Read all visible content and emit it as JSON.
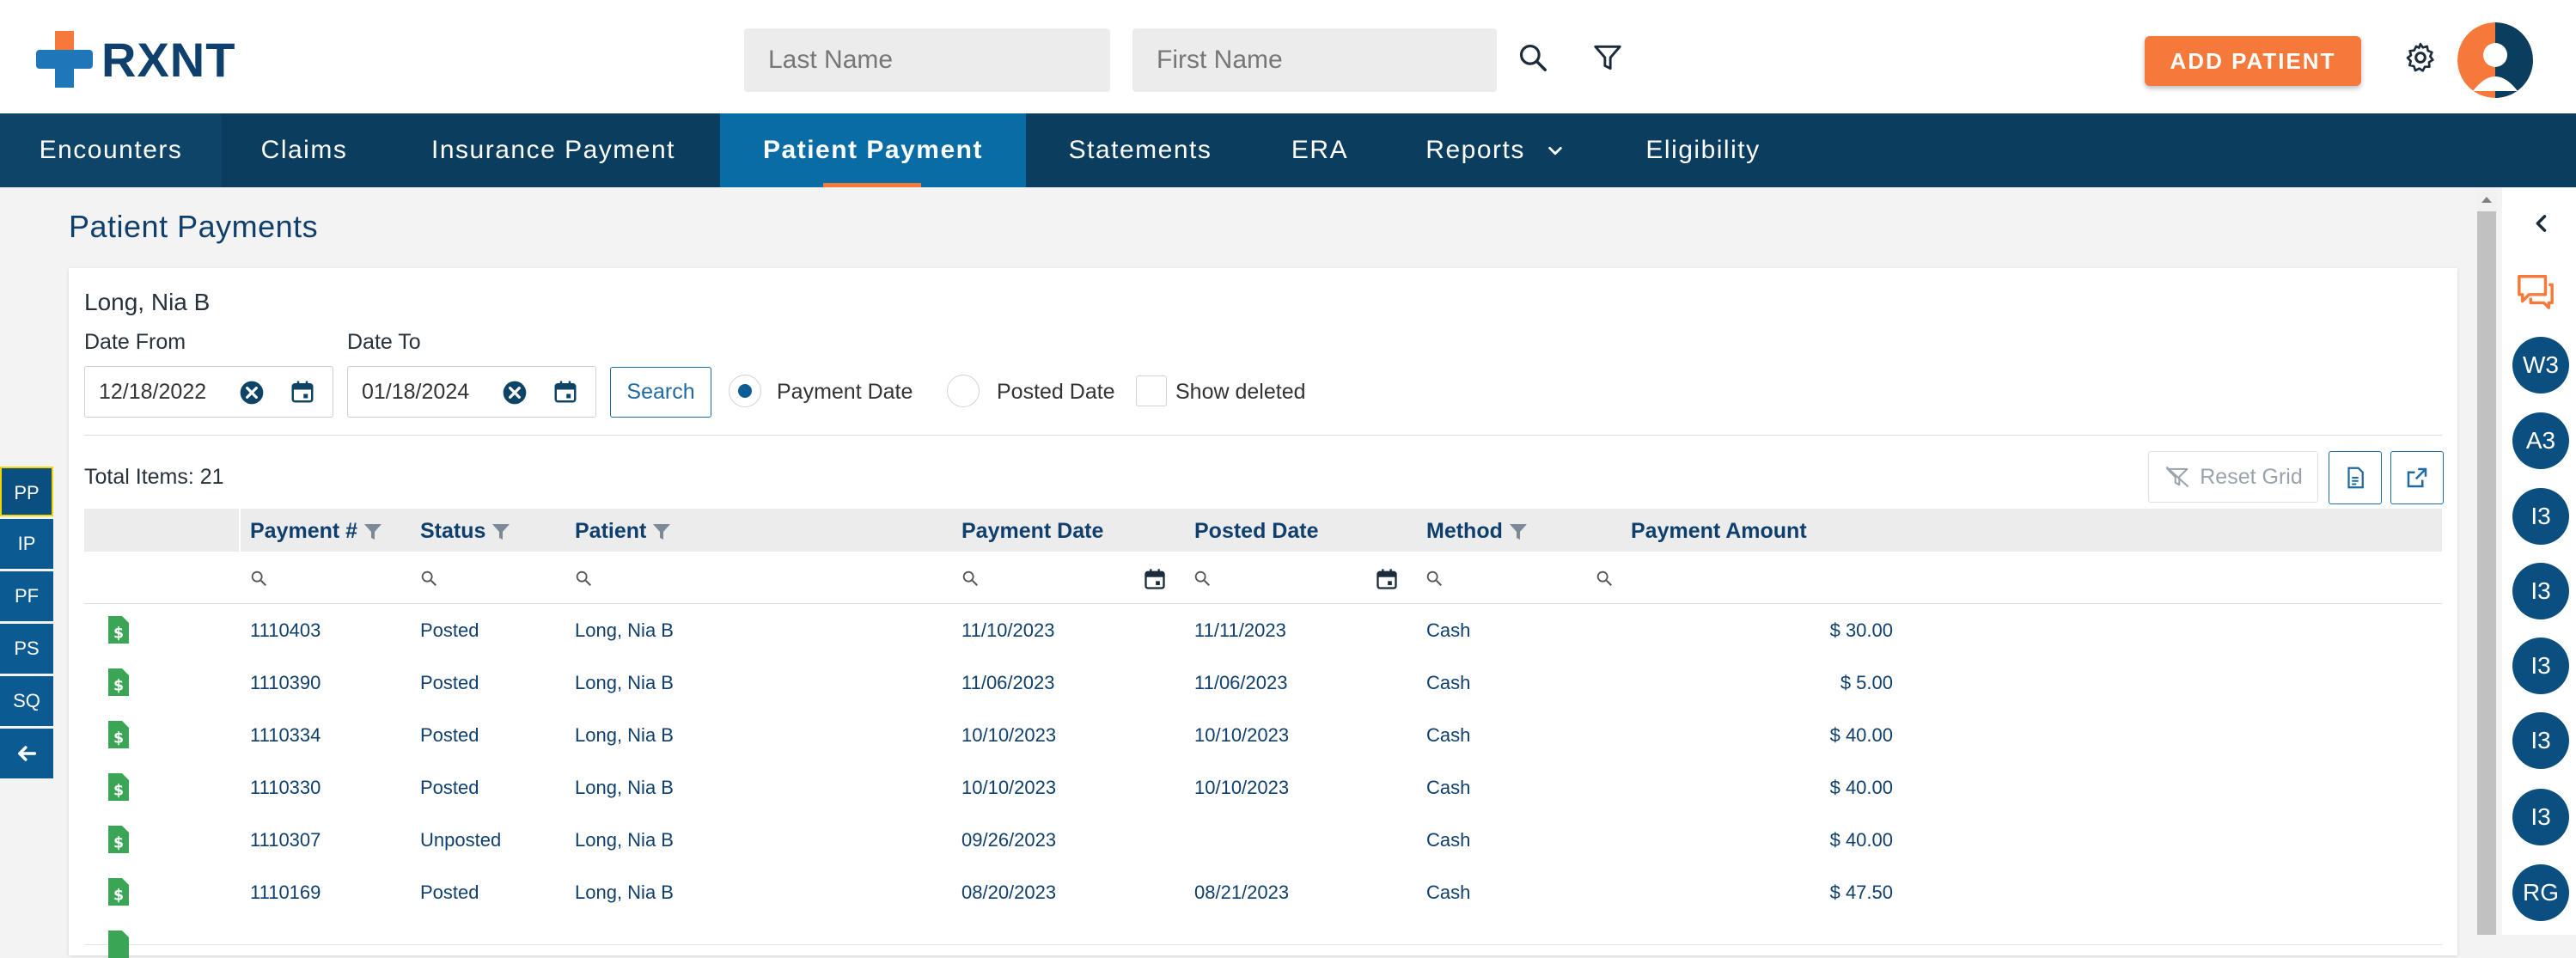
{
  "header": {
    "logo_text": "RXNT",
    "last_name_placeholder": "Last Name",
    "first_name_placeholder": "First Name",
    "add_patient_label": "ADD PATIENT"
  },
  "nav": {
    "tabs": [
      {
        "label": "Encounters"
      },
      {
        "label": "Claims"
      },
      {
        "label": "Insurance Payment"
      },
      {
        "label": "Patient Payment"
      },
      {
        "label": "Statements"
      },
      {
        "label": "ERA"
      },
      {
        "label": "Reports"
      },
      {
        "label": "Eligibility"
      }
    ],
    "active": "Patient Payment"
  },
  "page": {
    "title": "Patient Payments",
    "patient_name": "Long, Nia B"
  },
  "filters": {
    "date_from_label": "Date From",
    "date_from_value": "12/18/2022",
    "date_to_label": "Date To",
    "date_to_value": "01/18/2024",
    "search_label": "Search",
    "payment_date_label": "Payment Date",
    "posted_date_label": "Posted Date",
    "show_deleted_label": "Show deleted",
    "selected_radio": "Payment Date"
  },
  "grid": {
    "total_items": "Total Items: 21",
    "reset_label": "Reset Grid",
    "columns": [
      "Payment #",
      "Status",
      "Patient",
      "Payment Date",
      "Posted Date",
      "Method",
      "Payment Amount"
    ],
    "rows": [
      {
        "payment_no": "1110403",
        "status": "Posted",
        "patient": "Long, Nia B",
        "payment_date": "11/10/2023",
        "posted_date": "11/11/2023",
        "method": "Cash",
        "amount": "$ 30.00"
      },
      {
        "payment_no": "1110390",
        "status": "Posted",
        "patient": "Long, Nia B",
        "payment_date": "11/06/2023",
        "posted_date": "11/06/2023",
        "method": "Cash",
        "amount": "$ 5.00"
      },
      {
        "payment_no": "1110334",
        "status": "Posted",
        "patient": "Long, Nia B",
        "payment_date": "10/10/2023",
        "posted_date": "10/10/2023",
        "method": "Cash",
        "amount": "$ 40.00"
      },
      {
        "payment_no": "1110330",
        "status": "Posted",
        "patient": "Long, Nia B",
        "payment_date": "10/10/2023",
        "posted_date": "10/10/2023",
        "method": "Cash",
        "amount": "$ 40.00"
      },
      {
        "payment_no": "1110307",
        "status": "Unposted",
        "patient": "Long, Nia B",
        "payment_date": "09/26/2023",
        "posted_date": "",
        "method": "Cash",
        "amount": "$ 40.00"
      },
      {
        "payment_no": "1110169",
        "status": "Posted",
        "patient": "Long, Nia B",
        "payment_date": "08/20/2023",
        "posted_date": "08/21/2023",
        "method": "Cash",
        "amount": "$ 47.50"
      }
    ]
  },
  "side_tabs": [
    "PP",
    "IP",
    "PF",
    "PS",
    "SQ"
  ],
  "right_rail": [
    "W3",
    "A3",
    "I3",
    "I3",
    "I3",
    "I3",
    "I3",
    "RG"
  ],
  "colors": {
    "brand_navy": "#0b3d5e",
    "active_tab": "#0a6ca5",
    "accent_orange": "#f5793a",
    "title_blue": "#0e3f6d",
    "doc_green": "#3aa655"
  }
}
